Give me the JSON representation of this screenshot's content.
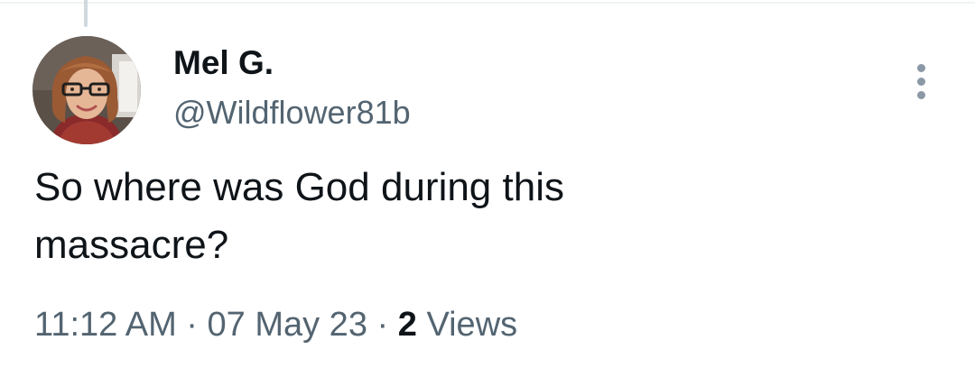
{
  "tweet": {
    "display_name": "Mel G.",
    "handle": "@Wildflower81b",
    "text": "So where was God during this\nmassacre?",
    "time": "11:12 AM",
    "separator": "·",
    "date": "07 May 23",
    "views_count": "2",
    "views_label": "Views",
    "more_icon": "more-vertical-icon",
    "avatar_icon": "profile-photo"
  },
  "colors": {
    "text_primary": "#0f1419",
    "text_secondary": "#536471",
    "thread_line": "#cfd9de",
    "divider": "#eff3f4"
  }
}
